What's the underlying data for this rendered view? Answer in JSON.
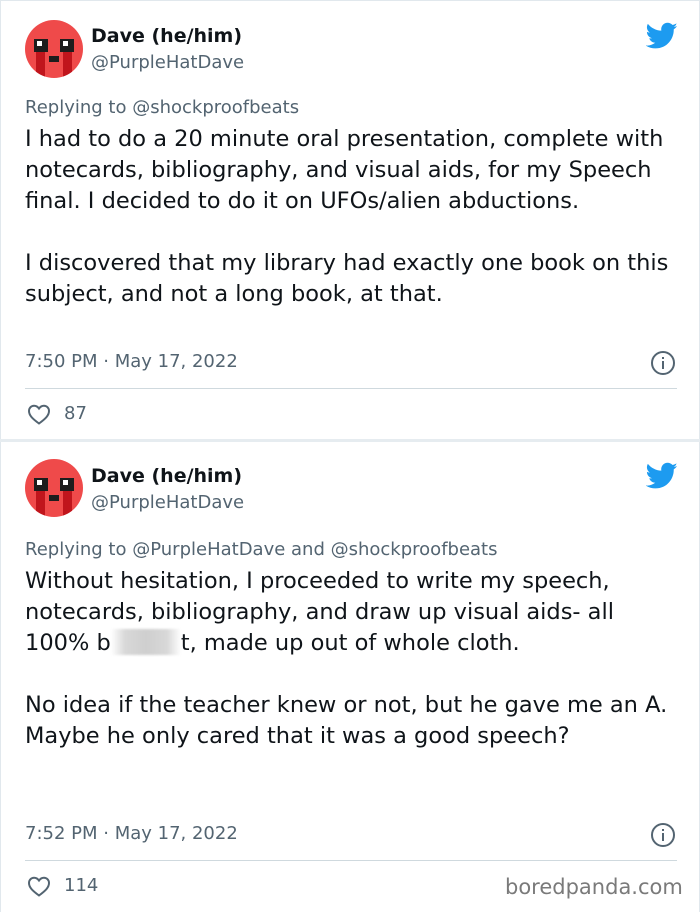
{
  "brand_color": "#1d9bf0",
  "tweets": [
    {
      "author_name": "Dave (he/him)",
      "author_handle": "@PurpleHatDave",
      "replying_prefix": "Replying to",
      "replying_to": "@shockproofbeats",
      "paragraphs": [
        "I had to do a 20 minute oral presentation, complete with notecards, bibliography, and visual aids, for my Speech final. I decided to do it on UFOs/alien abductions.",
        "I discovered that my library had exactly one book on this subject, and not a long book, at that."
      ],
      "timestamp": "7:50 PM · May 17, 2022",
      "like_count": "87",
      "icons": [
        "avatar",
        "twitter-bird-icon",
        "info-icon",
        "heart-icon"
      ]
    },
    {
      "author_name": "Dave (he/him)",
      "author_handle": "@PurpleHatDave",
      "replying_prefix": "Replying to",
      "replying_to": "@PurpleHatDave and @shockproofbeats",
      "paragraph1_before": "Without hesitation, I proceeded to write my speech, notecards, bibliography, and draw up visual aids- all 100% b",
      "paragraph1_after": "t, made up out of whole cloth.",
      "paragraph2": "No idea if the teacher knew or not, but he gave me an A. Maybe he only cared that it was a good speech?",
      "timestamp": "7:52 PM · May 17, 2022",
      "like_count": "114",
      "icons": [
        "avatar",
        "twitter-bird-icon",
        "info-icon",
        "heart-icon"
      ]
    }
  ],
  "watermark": "boredpanda.com"
}
